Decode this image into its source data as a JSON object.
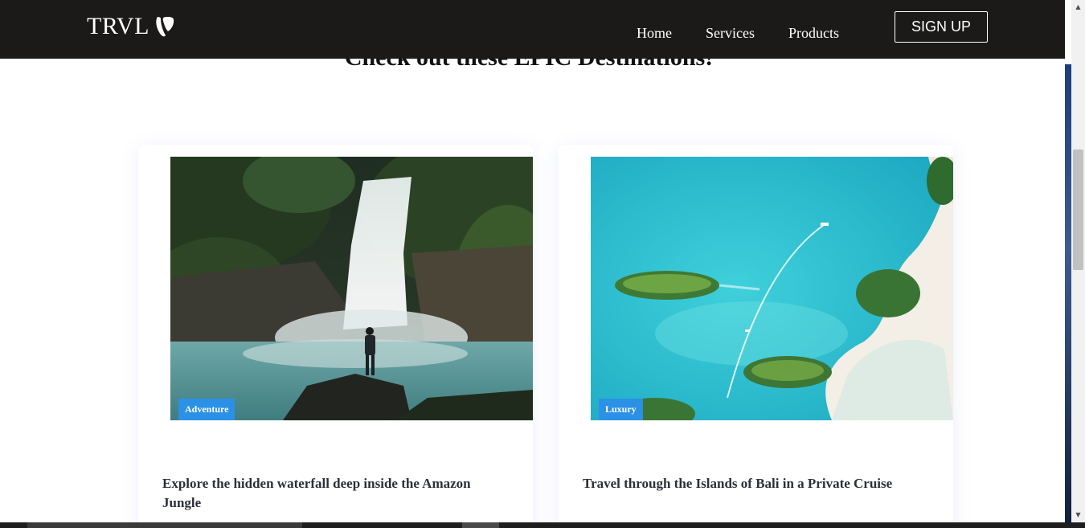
{
  "header": {
    "brand": "TRVL",
    "brand_icon": "typo3-logo-icon",
    "nav": [
      "Home",
      "Services",
      "Products"
    ],
    "signup_label": "SIGN UP"
  },
  "main": {
    "section_title": "Check out these EPIC Destinations!",
    "cards": [
      {
        "tag": "Adventure",
        "title": "Explore the hidden waterfall deep inside the Amazon Jungle",
        "image": "waterfall-photo"
      },
      {
        "tag": "Luxury",
        "title": "Travel through the Islands of Bali in a Private Cruise",
        "image": "bali-islands-aerial-photo"
      }
    ]
  },
  "colors": {
    "navbar": "#1b1a19",
    "tag": "#2b91e6",
    "card_title": "#2c2f3a"
  }
}
